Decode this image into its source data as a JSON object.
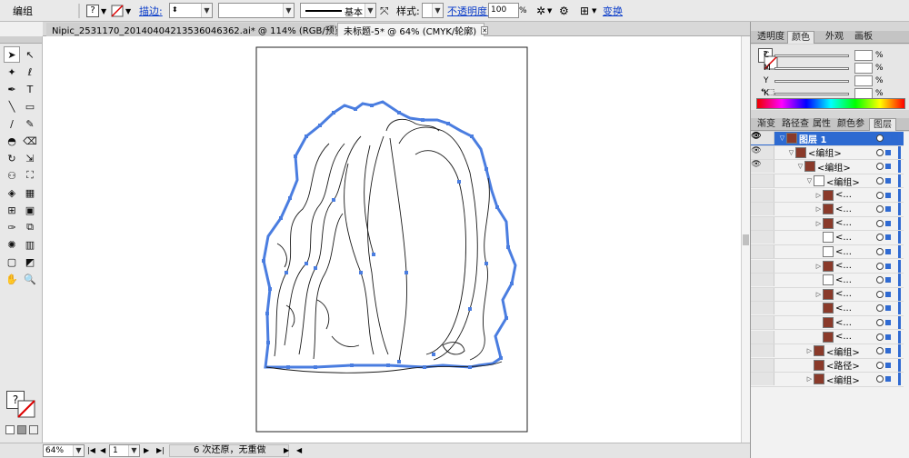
{
  "control_bar": {
    "object_type": "编组",
    "stroke_label": "描边:",
    "stroke_style": "基本",
    "style_label": "样式:",
    "opacity_label": "不透明度:",
    "opacity_value": "100",
    "opacity_unit": "%",
    "transform_label": "变换"
  },
  "documents": [
    {
      "label": "Nipic_2531170_20140404213536046362.ai* @ 114% (RGB/预览)",
      "active": false
    },
    {
      "label": "未标题-5* @ 64% (CMYK/轮廓)",
      "active": true
    }
  ],
  "status_bar": {
    "zoom": "64%",
    "artboard": "1",
    "history": "6 次还原，无重做"
  },
  "color_panel": {
    "tabs": [
      "透明度",
      "颜色",
      "外观",
      "画板"
    ],
    "active_tab": "颜色",
    "channels": [
      "C",
      "M",
      "Y",
      "K"
    ],
    "percent": "%"
  },
  "layers_panel": {
    "tabs": [
      "渐变",
      "路径查",
      "属性",
      "颜色参",
      "图层"
    ],
    "active_tab": "图层",
    "rows": [
      {
        "label": "图层 1",
        "indent": 0,
        "top": true,
        "eye": true,
        "arrow": "▽",
        "thumb": "c"
      },
      {
        "label": "<编组>",
        "indent": 1,
        "eye": true,
        "arrow": "▽",
        "thumb": "c"
      },
      {
        "label": "<编组>",
        "indent": 2,
        "eye": true,
        "arrow": "▽",
        "thumb": "c"
      },
      {
        "label": "<编组>",
        "indent": 3,
        "eye": false,
        "arrow": "▽",
        "thumb": "w"
      },
      {
        "label": "<...",
        "indent": 4,
        "eye": false,
        "arrow": "▷",
        "thumb": "c"
      },
      {
        "label": "<...",
        "indent": 4,
        "eye": false,
        "arrow": "▷",
        "thumb": "c"
      },
      {
        "label": "<...",
        "indent": 4,
        "eye": false,
        "arrow": "▷",
        "thumb": "c"
      },
      {
        "label": "<...",
        "indent": 4,
        "eye": false,
        "arrow": "",
        "thumb": "w"
      },
      {
        "label": "<...",
        "indent": 4,
        "eye": false,
        "arrow": "",
        "thumb": "w"
      },
      {
        "label": "<...",
        "indent": 4,
        "eye": false,
        "arrow": "▷",
        "thumb": "c"
      },
      {
        "label": "<...",
        "indent": 4,
        "eye": false,
        "arrow": "",
        "thumb": "w"
      },
      {
        "label": "<...",
        "indent": 4,
        "eye": false,
        "arrow": "▷",
        "thumb": "c"
      },
      {
        "label": "<...",
        "indent": 4,
        "eye": false,
        "arrow": "",
        "thumb": "c"
      },
      {
        "label": "<...",
        "indent": 4,
        "eye": false,
        "arrow": "",
        "thumb": "c"
      },
      {
        "label": "<...",
        "indent": 4,
        "eye": false,
        "arrow": "",
        "thumb": "c"
      },
      {
        "label": "<编组>",
        "indent": 3,
        "eye": false,
        "arrow": "▷",
        "thumb": "c"
      },
      {
        "label": "<路径>",
        "indent": 3,
        "eye": false,
        "arrow": "",
        "thumb": "c"
      },
      {
        "label": "<编组>",
        "indent": 3,
        "eye": false,
        "arrow": "▷",
        "thumb": "c"
      }
    ]
  },
  "tool_icons": [
    "selection-tool-icon",
    "direct-selection-tool-icon",
    "magic-wand-tool-icon",
    "lasso-tool-icon",
    "pen-tool-icon",
    "type-tool-icon",
    "line-segment-tool-icon",
    "rectangle-tool-icon",
    "paintbrush-tool-icon",
    "pencil-tool-icon",
    "blob-brush-tool-icon",
    "eraser-tool-icon",
    "rotate-tool-icon",
    "scale-tool-icon",
    "width-tool-icon",
    "free-transform-tool-icon",
    "shape-builder-tool-icon",
    "perspective-grid-tool-icon",
    "mesh-tool-icon",
    "gradient-tool-icon",
    "eyedropper-tool-icon",
    "blend-tool-icon",
    "symbol-sprayer-tool-icon",
    "column-graph-tool-icon",
    "artboard-tool-icon",
    "slice-tool-icon",
    "hand-tool-icon",
    "zoom-tool-icon"
  ],
  "colors": {
    "accent": "#2f6ad2",
    "path_highlight": "#4a7de0",
    "layer_thumb": "#8a3a2a"
  }
}
